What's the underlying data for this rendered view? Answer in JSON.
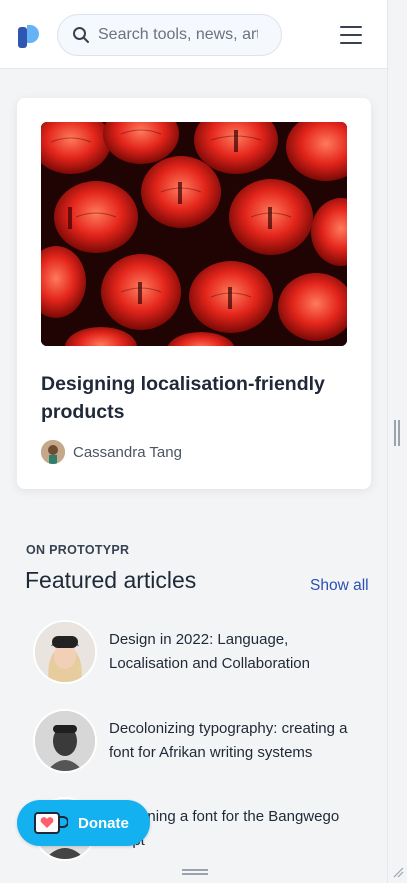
{
  "header": {
    "logo_icon": "prototypr-logo-icon",
    "search": {
      "placeholder": "Search tools, news, articles...",
      "value": ""
    },
    "menu_icon": "hamburger-menu-icon"
  },
  "feature_card": {
    "title": "Designing localisation-friendly products",
    "author": "Cassandra Tang"
  },
  "featured": {
    "eyebrow": "ON PROTOTYPR",
    "title": "Featured articles",
    "show_all": "Show all",
    "articles": [
      {
        "title": "Design in 2022: Language, Localisation and Collaboration"
      },
      {
        "title": "Decolonizing typography: creating a font for Afrikan writing systems"
      },
      {
        "title": "Designing a font for the Bangwego script"
      }
    ]
  },
  "donate": {
    "label": "Donate",
    "icon": "heart-cup-icon"
  },
  "colors": {
    "accent": "#13b1f0",
    "link": "#2b50b3",
    "brand": "#4b7fd6"
  }
}
